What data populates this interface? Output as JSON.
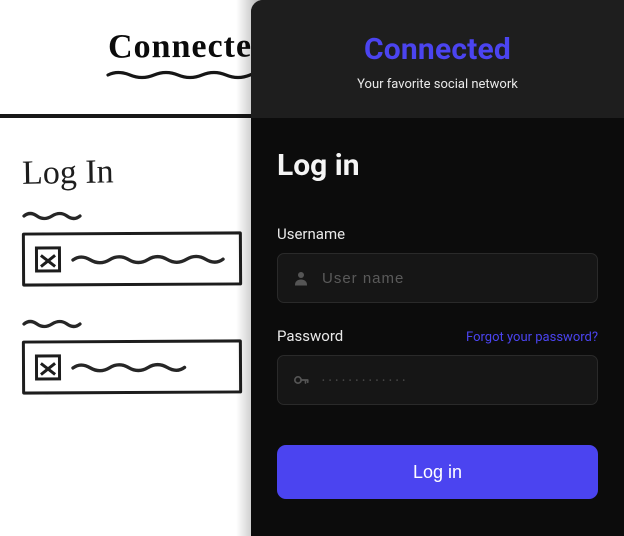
{
  "sketch": {
    "brand": "Connected",
    "heading": "Log In"
  },
  "app": {
    "brand": "Connected",
    "tagline": "Your favorite social network",
    "heading": "Log in",
    "username": {
      "label": "Username",
      "placeholder": "User name",
      "value": ""
    },
    "password": {
      "label": "Password",
      "forgot": "Forgot your password?",
      "placeholder": "•••••••••••••",
      "value": ""
    },
    "login_button": "Log in"
  },
  "colors": {
    "accent": "#4b44f0",
    "panel_bg": "#0c0c0c",
    "header_bg": "#1e1e1e",
    "input_bg": "#161616"
  }
}
